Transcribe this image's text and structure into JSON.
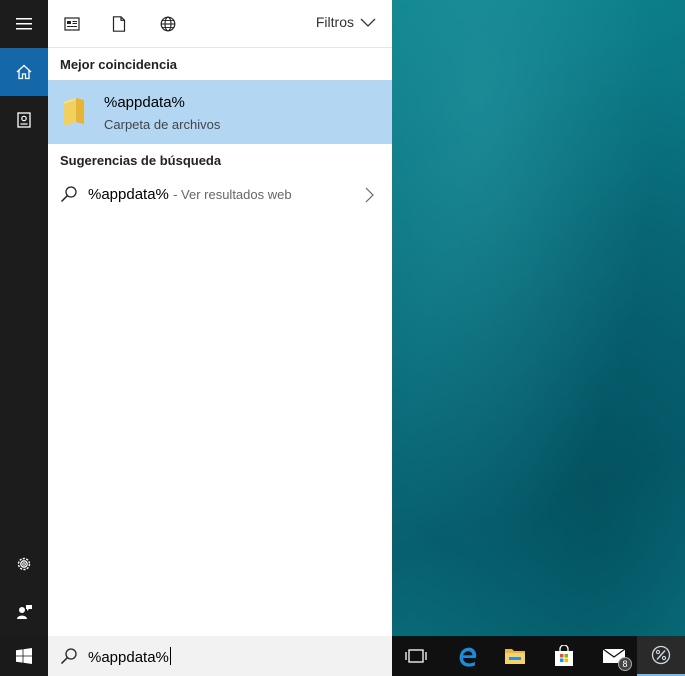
{
  "search_pane": {
    "filters_label": "Filtros",
    "best_match_header": "Mejor coincidencia",
    "best_match": {
      "title": "%appdata%",
      "subtitle": "Carpeta de archivos"
    },
    "suggestions_header": "Sugerencias de búsqueda",
    "suggestion": {
      "query": "%appdata%",
      "hint": "- Ver resultados web"
    }
  },
  "search_box": {
    "value": "%appdata%"
  },
  "taskbar": {
    "mail_badge": "8"
  },
  "colors": {
    "accent": "#1467a8",
    "selection": "#b3d7f3",
    "rail": "#1c1c1c",
    "taskbar": "#101010"
  }
}
